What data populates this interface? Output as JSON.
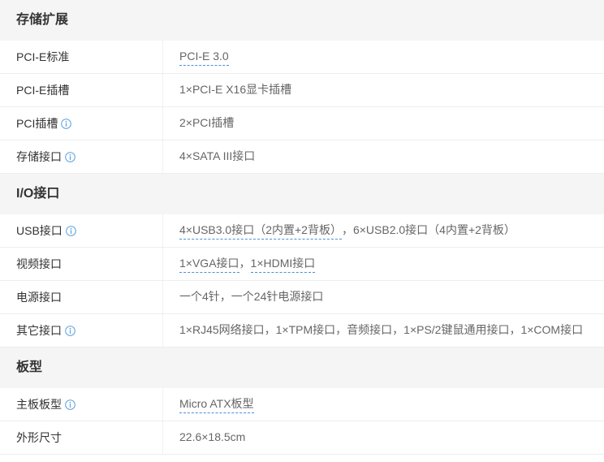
{
  "colors": {
    "header_background": "#f5f5f5",
    "label_text": "#333333",
    "value_text": "#666666",
    "link_underline": "#4a90d9",
    "info_icon": "#5a9fe0",
    "divider": "#eeeeee"
  },
  "icons": {
    "info": "info-circle-icon"
  },
  "sections": [
    {
      "title": "存储扩展",
      "rows": [
        {
          "label": "PCI-E标准",
          "has_info": false,
          "value": [
            {
              "text": "PCI-E 3.0",
              "link": true
            }
          ]
        },
        {
          "label": "PCI-E插槽",
          "has_info": false,
          "value": [
            {
              "text": "1×PCI-E X16显卡插槽",
              "link": false
            }
          ]
        },
        {
          "label": "PCI插槽",
          "has_info": true,
          "value": [
            {
              "text": "2×PCI插槽",
              "link": false
            }
          ]
        },
        {
          "label": "存储接口",
          "has_info": true,
          "value": [
            {
              "text": "4×SATA III接口",
              "link": false
            }
          ]
        }
      ]
    },
    {
      "title": "I/O接口",
      "rows": [
        {
          "label": "USB接口",
          "has_info": true,
          "value": [
            {
              "text": "4×USB3.0接口（2内置+2背板）",
              "link": true
            },
            {
              "text": "，6×USB2.0接口（4内置+2背板）",
              "link": false
            }
          ]
        },
        {
          "label": "视频接口",
          "has_info": false,
          "value": [
            {
              "text": "1×VGA接口",
              "link": true
            },
            {
              "text": "，",
              "link": false
            },
            {
              "text": "1×HDMI接口",
              "link": true
            }
          ]
        },
        {
          "label": "电源接口",
          "has_info": false,
          "value": [
            {
              "text": "一个4针，一个24针电源接口",
              "link": false
            }
          ]
        },
        {
          "label": "其它接口",
          "has_info": true,
          "value": [
            {
              "text": "1×RJ45网络接口，1×TPM接口，音频接口，1×PS/2键鼠通用接口，1×COM接口",
              "link": false
            }
          ]
        }
      ]
    },
    {
      "title": "板型",
      "rows": [
        {
          "label": "主板板型",
          "has_info": true,
          "value": [
            {
              "text": "Micro ATX板型",
              "link": true
            }
          ]
        },
        {
          "label": "外形尺寸",
          "has_info": false,
          "value": [
            {
              "text": "22.6×18.5cm",
              "link": false
            }
          ]
        }
      ]
    }
  ]
}
